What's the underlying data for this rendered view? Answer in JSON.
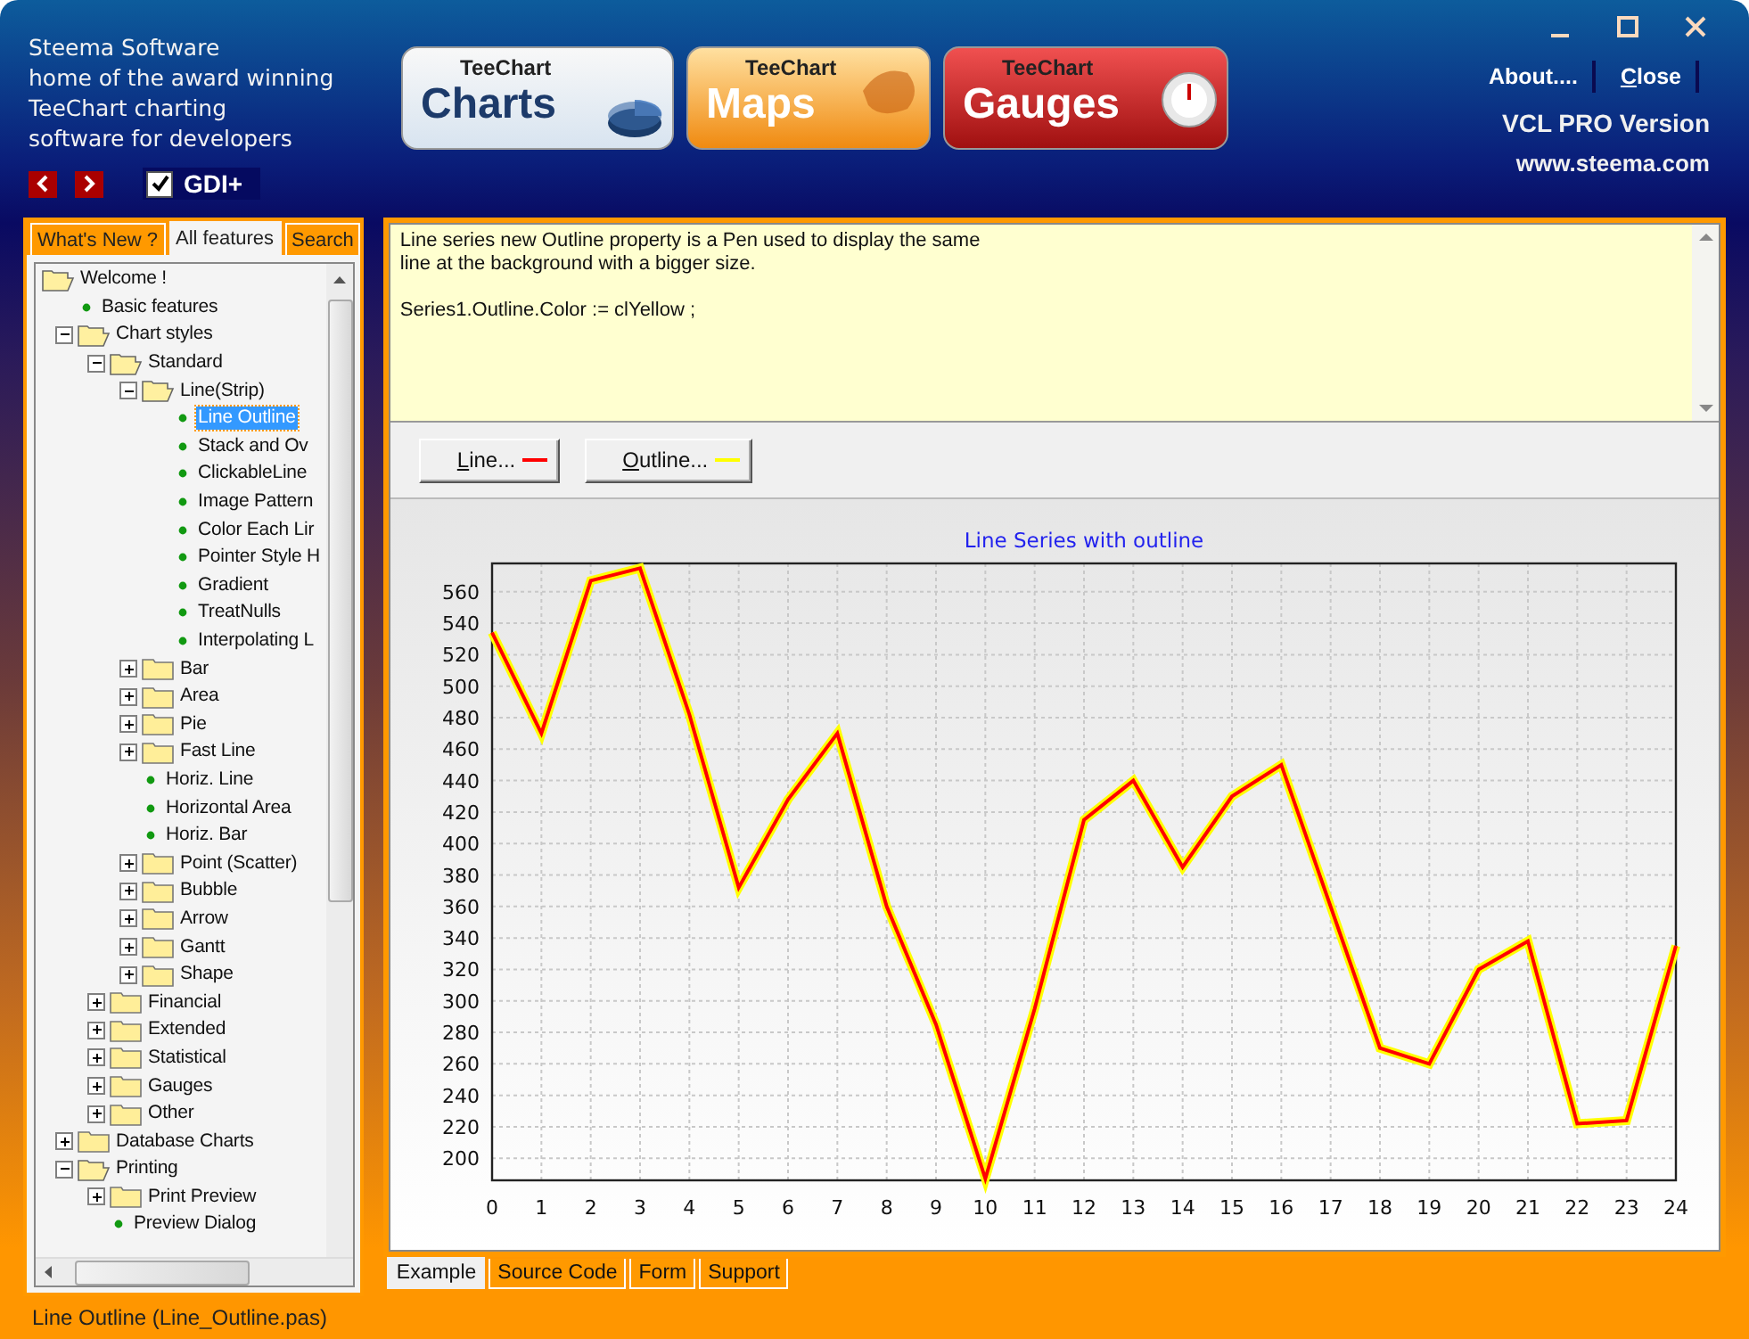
{
  "header": {
    "tagline": [
      "Steema Software",
      "home of the award winning",
      "TeeChart charting",
      "software for developers"
    ],
    "gdi_plus": {
      "label": "GDI+",
      "checked": true
    },
    "products": [
      {
        "brand": "TeeChart",
        "name": "Charts",
        "kind": "charts"
      },
      {
        "brand": "TeeChart",
        "name": "Maps",
        "kind": "maps"
      },
      {
        "brand": "TeeChart",
        "name": "Gauges",
        "kind": "gauges"
      }
    ],
    "buttons": [
      "About....",
      "Close"
    ],
    "edition": "VCL PRO Version",
    "website": "www.steema.com"
  },
  "sidebar": {
    "tabs": [
      {
        "label": "What's New ?",
        "selected": false
      },
      {
        "label": "All features",
        "selected": true
      },
      {
        "label": "Search",
        "selected": false
      }
    ],
    "tree": [
      {
        "label": "Welcome !",
        "kind": "folder",
        "expanded": true,
        "selected": false,
        "children": [
          {
            "label": "Basic features",
            "kind": "leaf",
            "selected": false
          },
          {
            "label": "Chart styles",
            "kind": "folder",
            "expanded": true,
            "selected": false,
            "children": [
              {
                "label": "Standard",
                "kind": "folder",
                "expanded": true,
                "selected": false,
                "children": [
                  {
                    "label": "Line(Strip)",
                    "kind": "folder",
                    "expanded": true,
                    "selected": false,
                    "children": [
                      {
                        "label": "Line Outline",
                        "kind": "leaf",
                        "selected": true
                      },
                      {
                        "label": "Stack and Ov",
                        "kind": "leaf",
                        "selected": false
                      },
                      {
                        "label": "ClickableLine",
                        "kind": "leaf",
                        "selected": false
                      },
                      {
                        "label": "Image Pattern",
                        "kind": "leaf",
                        "selected": false
                      },
                      {
                        "label": "Color Each Lir",
                        "kind": "leaf",
                        "selected": false
                      },
                      {
                        "label": "Pointer Style H",
                        "kind": "leaf",
                        "selected": false
                      },
                      {
                        "label": "Gradient",
                        "kind": "leaf",
                        "selected": false
                      },
                      {
                        "label": "TreatNulls",
                        "kind": "leaf",
                        "selected": false
                      },
                      {
                        "label": "Interpolating L",
                        "kind": "leaf",
                        "selected": false
                      }
                    ]
                  },
                  {
                    "label": "Bar",
                    "kind": "folder",
                    "expanded": false,
                    "selected": false
                  },
                  {
                    "label": "Area",
                    "kind": "folder",
                    "expanded": false,
                    "selected": false
                  },
                  {
                    "label": "Pie",
                    "kind": "folder",
                    "expanded": false,
                    "selected": false
                  },
                  {
                    "label": "Fast Line",
                    "kind": "folder",
                    "expanded": false,
                    "selected": false
                  },
                  {
                    "label": "Horiz. Line",
                    "kind": "leaf",
                    "selected": false
                  },
                  {
                    "label": "Horizontal Area",
                    "kind": "leaf",
                    "selected": false
                  },
                  {
                    "label": "Horiz. Bar",
                    "kind": "leaf",
                    "selected": false
                  },
                  {
                    "label": "Point (Scatter)",
                    "kind": "folder",
                    "expanded": false,
                    "selected": false
                  },
                  {
                    "label": "Bubble",
                    "kind": "folder",
                    "expanded": false,
                    "selected": false
                  },
                  {
                    "label": "Arrow",
                    "kind": "folder",
                    "expanded": false,
                    "selected": false
                  },
                  {
                    "label": "Gantt",
                    "kind": "folder",
                    "expanded": false,
                    "selected": false
                  },
                  {
                    "label": "Shape",
                    "kind": "folder",
                    "expanded": false,
                    "selected": false
                  }
                ]
              },
              {
                "label": "Financial",
                "kind": "folder",
                "expanded": false,
                "selected": false
              },
              {
                "label": "Extended",
                "kind": "folder",
                "expanded": false,
                "selected": false
              },
              {
                "label": "Statistical",
                "kind": "folder",
                "expanded": false,
                "selected": false
              },
              {
                "label": "Gauges",
                "kind": "folder",
                "expanded": false,
                "selected": false
              },
              {
                "label": "Other",
                "kind": "folder",
                "expanded": false,
                "selected": false
              }
            ]
          },
          {
            "label": "Database Charts",
            "kind": "folder",
            "expanded": false,
            "selected": false
          },
          {
            "label": "Printing",
            "kind": "folder",
            "expanded": true,
            "selected": false,
            "children": [
              {
                "label": "Print Preview",
                "kind": "folder",
                "expanded": false,
                "selected": false
              },
              {
                "label": "Preview Dialog",
                "kind": "leaf",
                "selected": false
              }
            ]
          }
        ]
      }
    ]
  },
  "example": {
    "description": [
      "Line series new Outline property is a Pen used to display the same",
      "line at the background with a bigger size."
    ],
    "code": "Series1.Outline.Color := clYellow ;",
    "pen_buttons": [
      {
        "label": "Line...",
        "color": "#ff0000"
      },
      {
        "label": "Outline...",
        "color": "#ffff00"
      }
    ],
    "chart_data": {
      "type": "line",
      "grid": true,
      "title": "Line Series with outline",
      "x": [
        0,
        1,
        2,
        3,
        4,
        5,
        6,
        7,
        8,
        9,
        10,
        11,
        12,
        13,
        14,
        15,
        16,
        17,
        18,
        19,
        20,
        21,
        22,
        23,
        24
      ],
      "xlim": [
        0,
        24
      ],
      "ylim": [
        186,
        578
      ],
      "xticks": [
        0,
        1,
        2,
        3,
        4,
        5,
        6,
        7,
        8,
        9,
        10,
        11,
        12,
        13,
        14,
        15,
        16,
        17,
        18,
        19,
        20,
        21,
        22,
        23,
        24
      ],
      "yticks": [
        200,
        220,
        240,
        260,
        280,
        300,
        320,
        340,
        360,
        380,
        400,
        420,
        440,
        460,
        480,
        500,
        520,
        540,
        560
      ],
      "series": [
        {
          "color": "#ff0000",
          "values": [
            534,
            470,
            567,
            575,
            482,
            372,
            428,
            470,
            360,
            285,
            187,
            295,
            415,
            440,
            385,
            430,
            450,
            360,
            270,
            260,
            320,
            338,
            222,
            224,
            335
          ]
        }
      ]
    }
  },
  "bottom_tabs": [
    {
      "label": "Example",
      "selected": true
    },
    {
      "label": "Source Code",
      "selected": false
    },
    {
      "label": "Form",
      "selected": false
    },
    {
      "label": "Support",
      "selected": false
    }
  ],
  "status_bar": "Line Outline (Line_Outline.pas)"
}
